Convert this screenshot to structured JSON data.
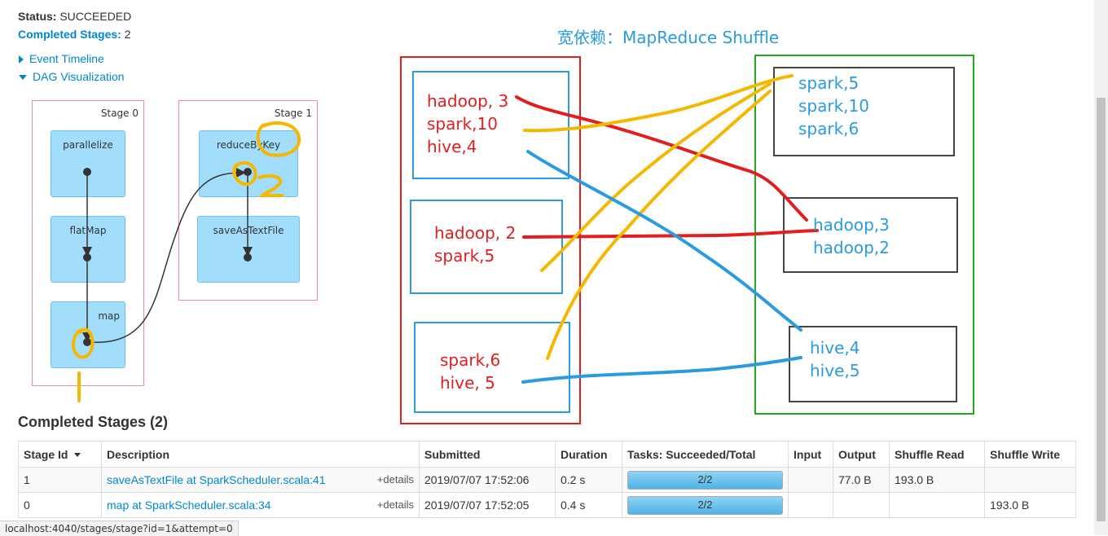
{
  "summary": {
    "status_label": "Status:",
    "status_value": "SUCCEEDED",
    "completed_label": "Completed Stages:",
    "completed_value": "2",
    "event_timeline": "Event Timeline",
    "dag_visualization": "DAG Visualization"
  },
  "dag": {
    "stage0": {
      "label": "Stage 0",
      "nodes": [
        "parallelize",
        "flatMap",
        "map"
      ]
    },
    "stage1": {
      "label": "Stage 1",
      "nodes": [
        "reduceByKey",
        "saveAsTextFile"
      ]
    }
  },
  "annotation": {
    "title": "宽依赖：MapReduce Shuffle",
    "map_partitions": [
      "hadoop, 3\nspark,10\nhive,4",
      "hadoop, 2\nspark,5",
      "spark,6\nhive, 5"
    ],
    "reduce_partitions": [
      "spark,5\nspark,10\nspark,6",
      "hadoop,3\nhadoop,2",
      "hive,4\nhive,5"
    ],
    "colors": {
      "red": "#e02020",
      "blue": "#2a9be0",
      "yellow": "#f5b800",
      "green": "#22aa22",
      "gray": "#444444"
    }
  },
  "completed_stages": {
    "heading": "Completed Stages (2)",
    "columns": [
      "Stage Id",
      "Description",
      "Submitted",
      "Duration",
      "Tasks: Succeeded/Total",
      "Input",
      "Output",
      "Shuffle Read",
      "Shuffle Write"
    ],
    "details_label": "+details",
    "rows": [
      {
        "id": "1",
        "description": "saveAsTextFile at SparkScheduler.scala:41",
        "submitted": "2019/07/07 17:52:06",
        "duration": "0.2 s",
        "tasks": "2/2",
        "tasks_fraction": 1.0,
        "input": "",
        "output": "77.0 B",
        "shuffle_read": "193.0 B",
        "shuffle_write": ""
      },
      {
        "id": "0",
        "description": "map at SparkScheduler.scala:34",
        "submitted": "2019/07/07 17:52:05",
        "duration": "0.4 s",
        "tasks": "2/2",
        "tasks_fraction": 1.0,
        "input": "",
        "output": "",
        "shuffle_read": "",
        "shuffle_write": "193.0 B"
      }
    ]
  },
  "status_bar": {
    "url": "localhost:4040/stages/stage?id=1&attempt=0"
  }
}
